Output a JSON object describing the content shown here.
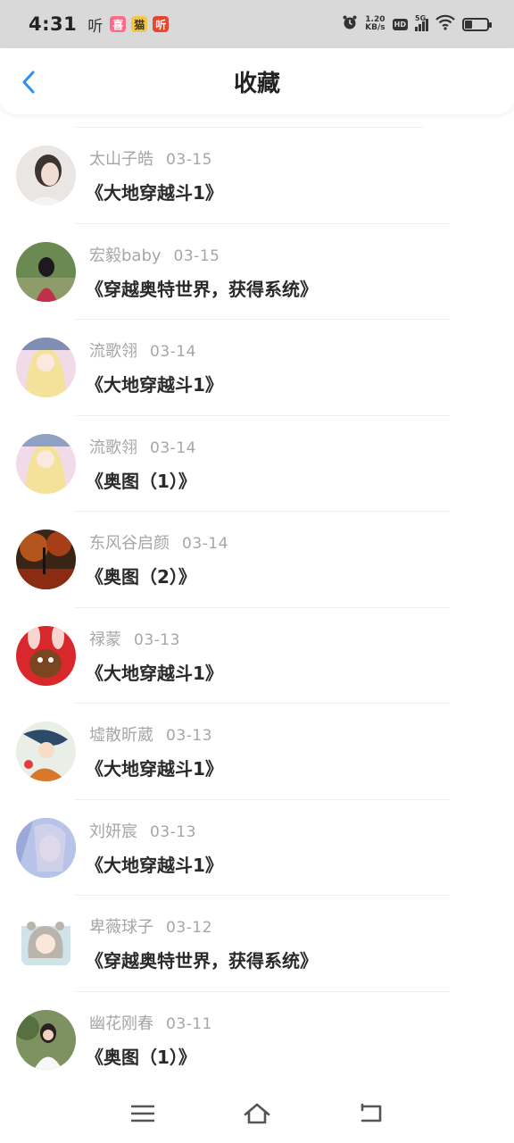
{
  "status_bar": {
    "time": "4:31",
    "notifications": [
      "听",
      "喜",
      "猫",
      "听"
    ],
    "speed_value": "1.20",
    "speed_unit": "KB/s",
    "hd": "HD",
    "network": "5G",
    "battery_level": 0.35,
    "icons": [
      "alarm-icon",
      "wifi-icon",
      "battery-icon",
      "signal-icon"
    ]
  },
  "header": {
    "title": "收藏",
    "back_icon": "chevron-left-icon",
    "accent_color": "#2f8ff0"
  },
  "favorites": [
    {
      "user": "太山子皓",
      "date": "03-15",
      "title": "《大地穿越斗1》"
    },
    {
      "user": "宏毅baby",
      "date": "03-15",
      "title": "《穿越奥特世界，获得系统》"
    },
    {
      "user": "流歌翎",
      "date": "03-14",
      "title": "《大地穿越斗1》"
    },
    {
      "user": "流歌翎",
      "date": "03-14",
      "title": "《奥图（1）》"
    },
    {
      "user": "东风谷启颜",
      "date": "03-14",
      "title": "《奥图（2）》"
    },
    {
      "user": "禄蒙",
      "date": "03-13",
      "title": "《大地穿越斗1》"
    },
    {
      "user": "墟散昕葳",
      "date": "03-13",
      "title": "《大地穿越斗1》"
    },
    {
      "user": "刘妍宸",
      "date": "03-13",
      "title": "《大地穿越斗1》"
    },
    {
      "user": "卑薇球子",
      "date": "03-12",
      "title": "《穿越奥特世界，获得系统》"
    },
    {
      "user": "幽花刚春",
      "date": "03-11",
      "title": "《奥图（1）》"
    }
  ],
  "system_nav": [
    "menu-icon",
    "home-icon",
    "back-icon"
  ]
}
